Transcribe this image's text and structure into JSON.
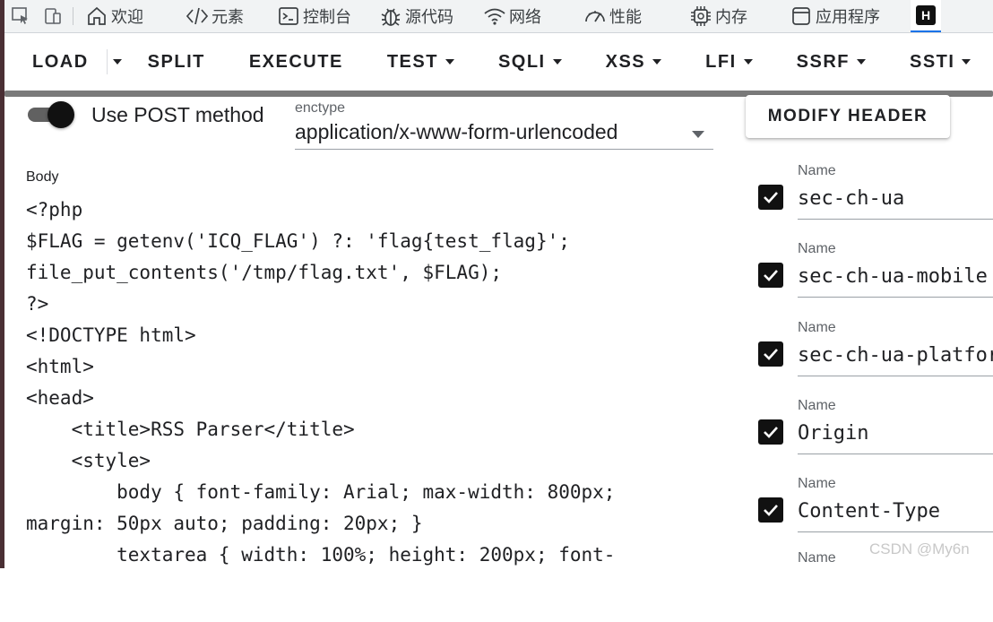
{
  "devtools": {
    "tabs": [
      {
        "label": "欢迎",
        "icon": "home-icon"
      },
      {
        "label": "元素",
        "icon": "code-brackets-icon"
      },
      {
        "label": "控制台",
        "icon": "console-icon"
      },
      {
        "label": "源代码",
        "icon": "bug-icon"
      },
      {
        "label": "网络",
        "icon": "wifi-icon"
      },
      {
        "label": "性能",
        "icon": "gauge-icon"
      },
      {
        "label": "内存",
        "icon": "chip-icon"
      },
      {
        "label": "应用程序",
        "icon": "app-window-icon"
      }
    ],
    "active_tab_badge": "H"
  },
  "toolbar": {
    "load": "LOAD",
    "split": "SPLIT",
    "execute": "EXECUTE",
    "test": "TEST",
    "sqli": "SQLI",
    "xss": "XSS",
    "lfi": "LFI",
    "ssrf": "SSRF",
    "ssti": "SSTI"
  },
  "form": {
    "post_toggle_label": "Use POST method",
    "post_enabled": true,
    "enctype_label": "enctype",
    "enctype_value": "application/x-www-form-urlencoded",
    "modify_header_label": "MODIFY HEADER",
    "body_label": "Body",
    "body_text": "<?php\n$FLAG = getenv('ICQ_FLAG') ?: 'flag{test_flag}';\nfile_put_contents('/tmp/flag.txt', $FLAG);\n?>\n<!DOCTYPE html>\n<html>\n<head>\n    <title>RSS Parser</title>\n    <style>\n        body { font-family: Arial; max-width: 800px;\nmargin: 50px auto; padding: 20px; }\n        textarea { width: 100%; height: 200px; font-"
  },
  "headers": {
    "name_label": "Name",
    "items": [
      {
        "value": "sec-ch-ua",
        "checked": true
      },
      {
        "value": "sec-ch-ua-mobile",
        "checked": true
      },
      {
        "value": "sec-ch-ua-platform",
        "checked": true
      },
      {
        "value": "Origin",
        "checked": true
      },
      {
        "value": "Content-Type",
        "checked": true
      }
    ]
  },
  "watermark": "CSDN @My6n"
}
